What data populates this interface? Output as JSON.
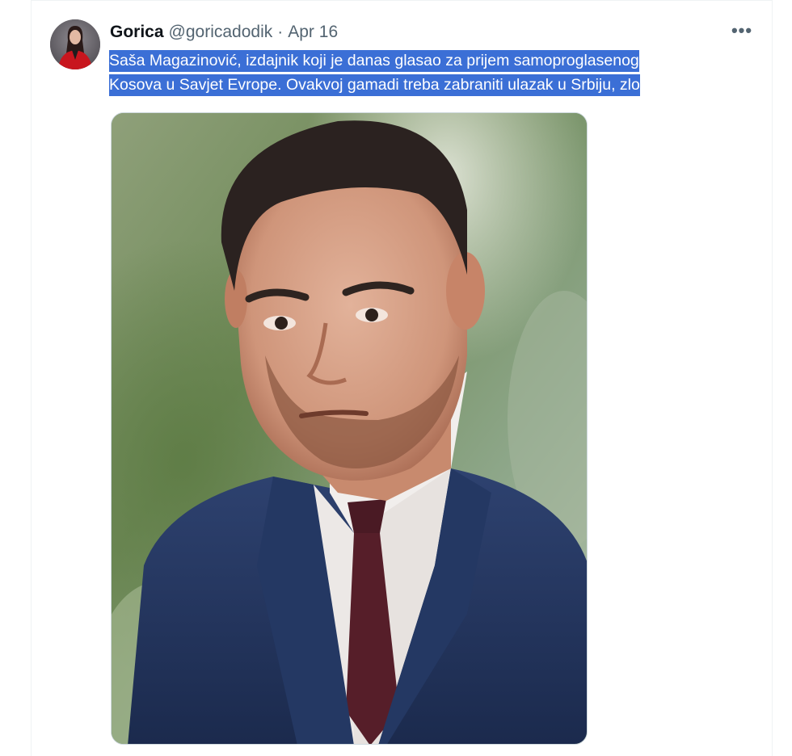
{
  "tweet": {
    "author": {
      "display_name": "Gorica",
      "handle": "@goricadodik",
      "avatar_icon": "user-avatar-photo"
    },
    "separator": "·",
    "date": "Apr 16",
    "more_icon": "more-horizontal-icon",
    "more_label": "•••",
    "text_lines": [
      "Saša Magazinović, izdajnik koji je danas glasao za prijem samoproglasenog",
      "Kosova u Savjet Evrope. Ovakvoj gamadi treba zabraniti ulazak u Srbiju, zlo"
    ],
    "selection_color": "#3b6fd6",
    "media": {
      "kind": "photo",
      "subject": "portrait-man-in-suit"
    }
  }
}
